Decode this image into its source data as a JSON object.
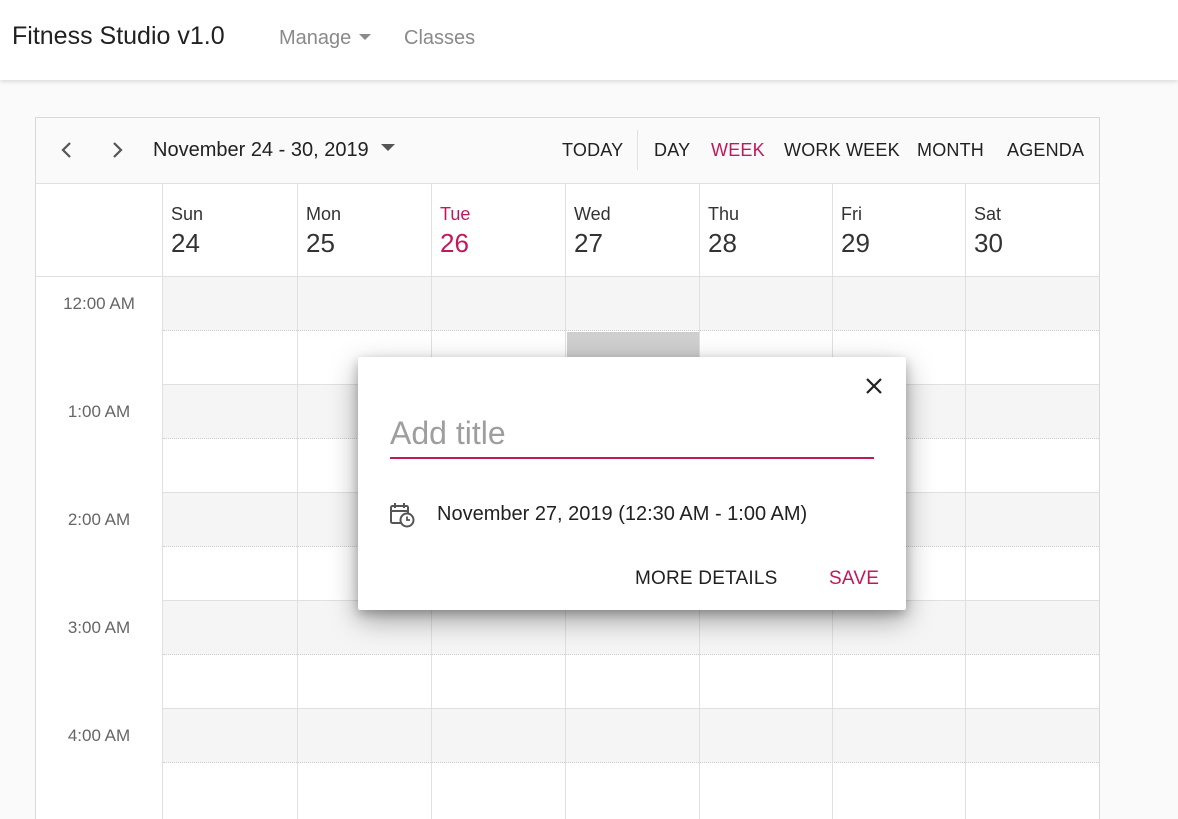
{
  "app": {
    "title": "Fitness Studio v1.0",
    "nav": {
      "manage": "Manage",
      "classes": "Classes"
    }
  },
  "toolbar": {
    "date_range": "November 24 - 30, 2019",
    "today": "TODAY",
    "views": [
      "DAY",
      "WEEK",
      "WORK WEEK",
      "MONTH",
      "AGENDA"
    ],
    "active_view": "WEEK"
  },
  "days": [
    {
      "name": "Sun",
      "date": "24"
    },
    {
      "name": "Mon",
      "date": "25"
    },
    {
      "name": "Tue",
      "date": "26",
      "today": true
    },
    {
      "name": "Wed",
      "date": "27"
    },
    {
      "name": "Thu",
      "date": "28"
    },
    {
      "name": "Fri",
      "date": "29"
    },
    {
      "name": "Sat",
      "date": "30"
    }
  ],
  "time_slots": [
    "12:00 AM",
    "1:00 AM",
    "2:00 AM",
    "3:00 AM",
    "4:00 AM"
  ],
  "popup": {
    "title_placeholder": "Add title",
    "date_time": "November 27, 2019 (12:30 AM - 1:00 AM)",
    "more_details": "MORE DETAILS",
    "save": "SAVE"
  },
  "colors": {
    "accent": "#c2185b",
    "selected_slot": "#cfcfcf"
  },
  "icons": [
    "chevron-left-icon",
    "chevron-right-icon",
    "caret-down-icon",
    "close-icon",
    "calendar-clock-icon"
  ]
}
